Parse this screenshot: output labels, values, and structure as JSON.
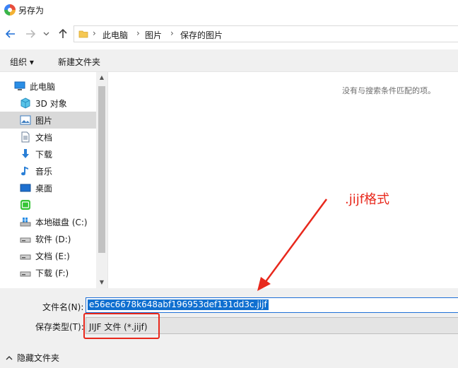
{
  "window": {
    "title": "另存为"
  },
  "nav": {
    "breadcrumbs": [
      "此电脑",
      "图片",
      "保存的图片"
    ],
    "separator": "›"
  },
  "toolbar": {
    "organize_label": "组织 ▾",
    "new_folder_label": "新建文件夹"
  },
  "sidebar": {
    "items": [
      {
        "label": "此电脑",
        "icon": "computer-icon",
        "selected": false
      },
      {
        "label": "3D 对象",
        "icon": "cube-3d-icon",
        "selected": false
      },
      {
        "label": "图片",
        "icon": "pictures-icon",
        "selected": true
      },
      {
        "label": "文档",
        "icon": "document-icon",
        "selected": false
      },
      {
        "label": "下载",
        "icon": "download-arrow-icon",
        "selected": false
      },
      {
        "label": "音乐",
        "icon": "music-note-icon",
        "selected": false
      },
      {
        "label": "桌面",
        "icon": "desktop-icon",
        "selected": false
      },
      {
        "label": "",
        "icon": "iqiyi-app-icon",
        "selected": false
      },
      {
        "label": "本地磁盘 (C:)",
        "icon": "windows-drive-icon",
        "selected": false
      },
      {
        "label": "软件 (D:)",
        "icon": "drive-icon",
        "selected": false
      },
      {
        "label": "文档 (E:)",
        "icon": "drive-icon",
        "selected": false
      },
      {
        "label": "下载 (F:)",
        "icon": "drive-icon",
        "selected": false
      }
    ]
  },
  "content": {
    "empty_message": "没有与搜索条件匹配的项。"
  },
  "form": {
    "filename_label": "文件名(N):",
    "filename_value": "e56ec6678k648abf196953def131dd3c.jijf",
    "type_label": "保存类型(T):",
    "type_value": "JIJF 文件 (*.jijf)"
  },
  "footer": {
    "hide_folders_label": "隐藏文件夹"
  },
  "annotation": {
    "label": ".jijf格式"
  },
  "colors": {
    "accent": "#1e6fd6",
    "annotation": "#e8281c",
    "selection": "#0f6fd0"
  }
}
